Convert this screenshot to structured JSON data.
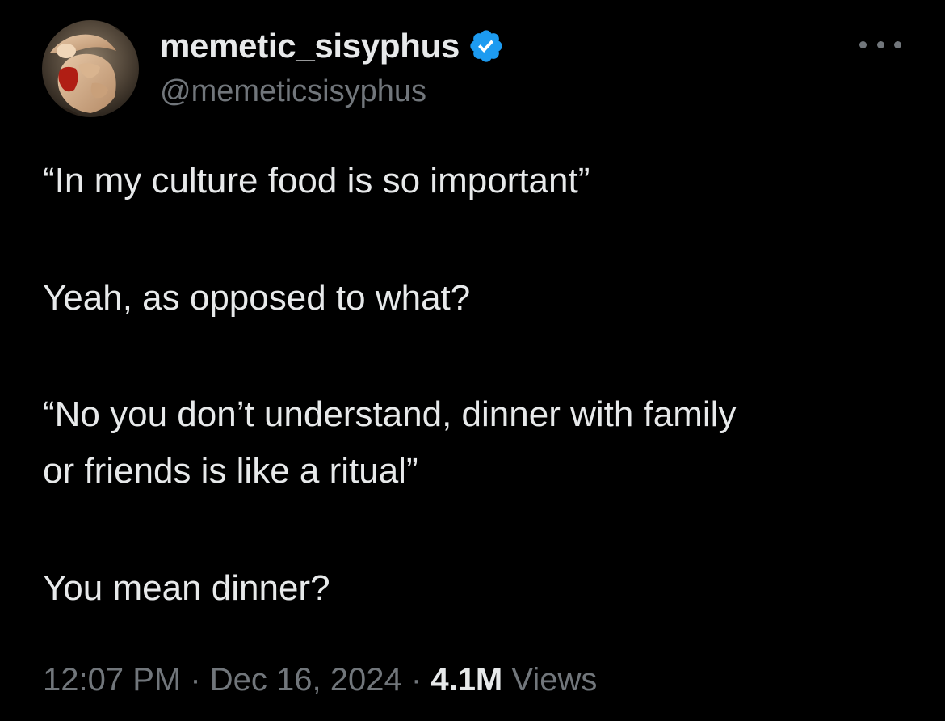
{
  "author": {
    "display_name": "memetic_sisyphus",
    "handle": "@memeticsisyphus",
    "verified": true,
    "avatar_icon": "classical-painting-avatar"
  },
  "tweet": {
    "lines": {
      "l1": "“In my culture food is so important”",
      "l2": "Yeah, as opposed to what?",
      "l3": "“No you don’t understand, dinner with family",
      "l4": "or friends is like a ritual”",
      "l5": "You mean dinner?"
    }
  },
  "meta": {
    "time": "12:07 PM",
    "separator": "·",
    "date": "Dec 16, 2024",
    "views_count": "4.1M",
    "views_label": "Views"
  },
  "icons": {
    "verified": "verified-badge-icon",
    "more": "more-options-icon"
  },
  "colors": {
    "background": "#000000",
    "primary_text": "#e7e9ea",
    "secondary_text": "#71767b",
    "verified_blue": "#1d9bf0"
  }
}
